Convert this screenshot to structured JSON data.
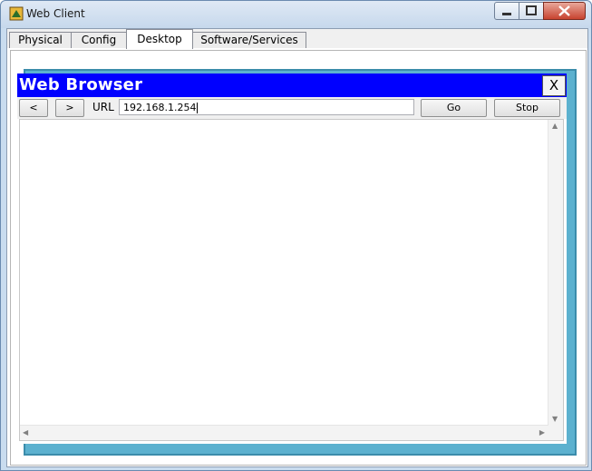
{
  "window": {
    "title": "Web Client",
    "icon": "packet-tracer-app-icon",
    "controls": [
      "minimize-icon",
      "maximize-icon",
      "close-icon"
    ]
  },
  "tabs": [
    {
      "label": "Physical",
      "active": false
    },
    {
      "label": "Config",
      "active": false
    },
    {
      "label": "Desktop",
      "active": true
    },
    {
      "label": "Software/Services",
      "active": false
    }
  ],
  "browser": {
    "title": "Web Browser",
    "close_label": "X",
    "back_label": "<",
    "forward_label": ">",
    "url_label": "URL",
    "url_value": "192.168.1.254",
    "go_label": "Go",
    "stop_label": "Stop"
  },
  "colors": {
    "browser_titlebar": "#0000ff",
    "desktop_frame": "#5cb1cf"
  }
}
